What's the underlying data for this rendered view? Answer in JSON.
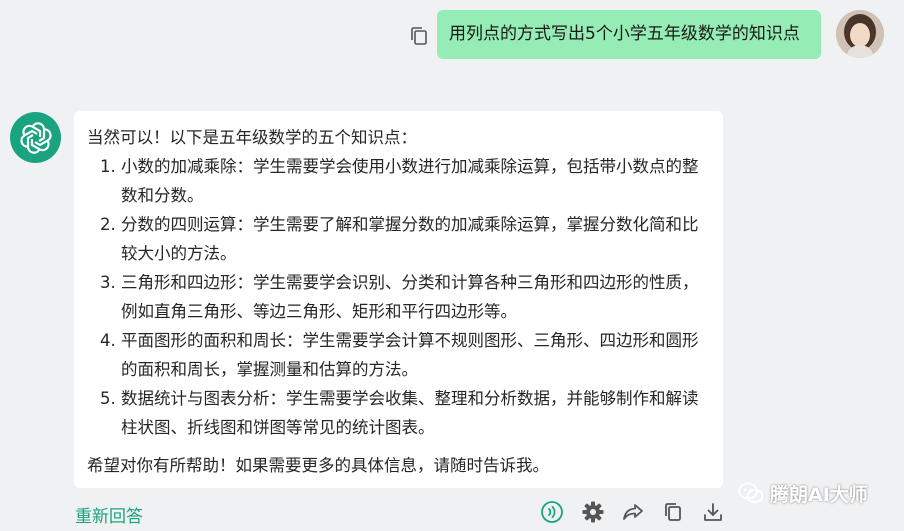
{
  "user_message": {
    "text": "用列点的方式写出5个小学五年级数学的知识点"
  },
  "assistant_message": {
    "intro": "当然可以！以下是五年级数学的五个知识点：",
    "items": [
      "小数的加减乘除：学生需要学会使用小数进行加减乘除运算，包括带小数点的整数和分数。",
      "分数的四则运算：学生需要了解和掌握分数的加减乘除运算，掌握分数化简和比较大小的方法。",
      "三角形和四边形：学生需要学会识别、分类和计算各种三角形和四边形的性质，例如直角三角形、等边三角形、矩形和平行四边形等。",
      "平面图形的面积和周长：学生需要学会计算不规则图形、三角形、四边形和圆形的面积和周长，掌握测量和估算的方法。",
      "数据统计与图表分析：学生需要学会收集、整理和分析数据，并能够制作和解读柱状图、折线图和饼图等常见的统计图表。"
    ],
    "closing": "希望对你有所帮助！如果需要更多的具体信息，请随时告诉我。"
  },
  "actions": {
    "regenerate_label": "重新回答",
    "icons": [
      "voice-icon",
      "gear-icon",
      "share-icon",
      "copy-icon",
      "download-icon"
    ]
  },
  "watermark": {
    "text": "腾朗AI大师"
  },
  "colors": {
    "accent": "#19a37f",
    "user_bubble": "#95ecb4",
    "background": "#f0f1f3"
  }
}
